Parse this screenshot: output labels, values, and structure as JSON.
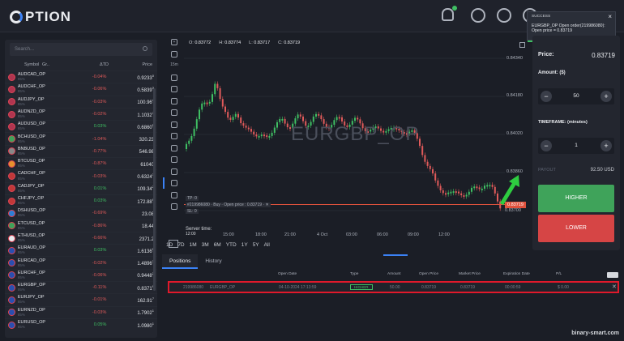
{
  "app": {
    "logo_text": "PTION"
  },
  "topbar": {
    "icons": [
      "bell-icon",
      "stats-icon",
      "gear-icon",
      "power-icon"
    ]
  },
  "toast": {
    "title": "SUCCESS",
    "line1": "EURGBP_OP Open order(219986080):",
    "line2": "Open price = 0.83719",
    "close": "×"
  },
  "search": {
    "placeholder": "Search..."
  },
  "assets_header": {
    "symbol": "Symbol",
    "group": "Gr..",
    "change": "ΔTD",
    "price": "Price"
  },
  "assets": [
    {
      "name": "AUDCAD_OP",
      "sub": "85%",
      "change": "-0.04%",
      "dir": "neg",
      "price": "0.9233",
      "sup": "0",
      "color": "#b03550"
    },
    {
      "name": "AUDCHF_OP",
      "sub": "85%",
      "change": "-0.06%",
      "dir": "neg",
      "price": "0.5839",
      "sup": "3",
      "color": "#b03550"
    },
    {
      "name": "AUDJPY_OP",
      "sub": "85%",
      "change": "-0.03%",
      "dir": "neg",
      "price": "100.96",
      "sup": "4",
      "color": "#b03550"
    },
    {
      "name": "AUDNZD_OP",
      "sub": "85%",
      "change": "-0.02%",
      "dir": "neg",
      "price": "1.1032",
      "sup": "7",
      "color": "#b03550"
    },
    {
      "name": "AUDUSD_OP",
      "sub": "85%",
      "change": "0.03%",
      "dir": "pos",
      "price": "0.6860",
      "sup": "5",
      "color": "#b03550"
    },
    {
      "name": "BCHUSD_OP",
      "sub": "85%",
      "change": "-1.04%",
      "dir": "neg",
      "price": "320.23",
      "sup": "",
      "color": "#3fa35a"
    },
    {
      "name": "BNBUSD_OP",
      "sub": "85%",
      "change": "-0.77%",
      "dir": "neg",
      "price": "546.98",
      "sup": "",
      "color": "#888"
    },
    {
      "name": "BTCUSD_OP",
      "sub": "85%",
      "change": "-0.87%",
      "dir": "neg",
      "price": "61040",
      "sup": "",
      "color": "#e8912d"
    },
    {
      "name": "CADCHF_OP",
      "sub": "85%",
      "change": "-0.03%",
      "dir": "neg",
      "price": "0.6324",
      "sup": "3",
      "color": "#c23838"
    },
    {
      "name": "CADJPY_OP",
      "sub": "85%",
      "change": "0.01%",
      "dir": "pos",
      "price": "109.34",
      "sup": "2",
      "color": "#c23838"
    },
    {
      "name": "CHFJPY_OP",
      "sub": "85%",
      "change": "0.03%",
      "dir": "pos",
      "price": "172.88",
      "sup": "9",
      "color": "#c23838"
    },
    {
      "name": "DSHUSD_OP",
      "sub": "85%",
      "change": "-0.69%",
      "dir": "neg",
      "price": "23.08",
      "sup": "",
      "color": "#2d7fd6"
    },
    {
      "name": "ETCUSD_OP",
      "sub": "85%",
      "change": "-0.86%",
      "dir": "neg",
      "price": "18.44",
      "sup": "",
      "color": "#3fa35a"
    },
    {
      "name": "ETHUSD_OP",
      "sub": "85%",
      "change": "-0.66%",
      "dir": "neg",
      "price": "2371.2",
      "sup": "",
      "color": "#e9ebef"
    },
    {
      "name": "EURAUD_OP",
      "sub": "85%",
      "change": "0.03%",
      "dir": "pos",
      "price": "1.6136",
      "sup": "9",
      "color": "#2a4fb0"
    },
    {
      "name": "EURCAD_OP",
      "sub": "85%",
      "change": "-0.02%",
      "dir": "neg",
      "price": "1.4896",
      "sup": "7",
      "color": "#2a4fb0"
    },
    {
      "name": "EURCHF_OP",
      "sub": "85%",
      "change": "-0.06%",
      "dir": "neg",
      "price": "0.9448",
      "sup": "2",
      "color": "#2a4fb0"
    },
    {
      "name": "EURGBP_OP",
      "sub": "85%",
      "change": "-0.11%",
      "dir": "neg",
      "price": "0.8371",
      "sup": "9",
      "color": "#2a4fb0"
    },
    {
      "name": "EURJPY_OP",
      "sub": "85%",
      "change": "-0.01%",
      "dir": "neg",
      "price": "162.91",
      "sup": "7",
      "color": "#2a4fb0"
    },
    {
      "name": "EURNZD_OP",
      "sub": "85%",
      "change": "-0.03%",
      "dir": "neg",
      "price": "1.7902",
      "sup": "1",
      "color": "#2a4fb0"
    },
    {
      "name": "EURUSD_OP",
      "sub": "85%",
      "change": "0.05%",
      "dir": "pos",
      "price": "1.0980",
      "sup": "1",
      "color": "#2a4fb0"
    }
  ],
  "chart": {
    "ohlc": {
      "o_label": "O:",
      "o": "0.83772",
      "h_label": "H:",
      "h": "0.83774",
      "l_label": "L:",
      "l": "0.83717",
      "c_label": "C:",
      "c": "0.83719"
    },
    "watermark": "EURGBP_OP",
    "interval": "15m",
    "y_ticks": [
      "0.84340",
      "0.84180",
      "0.84020",
      "0.83860",
      "0.83700"
    ],
    "current_tag": "0.83719",
    "x_ticks": [
      "15:00",
      "18:00",
      "21:00",
      "4 Oct",
      "03:00",
      "06:00",
      "09:00",
      "12:00"
    ],
    "tp_label": "TP: 0",
    "order_label": "#219986080 · Buy · Open price : 0.83719 · ✕",
    "sl_label": "SL: 0",
    "server_time_label": "Server time:",
    "server_time_value": "12:00",
    "ranges": [
      "1D",
      "7D",
      "1M",
      "3M",
      "6M",
      "YTD",
      "1Y",
      "5Y",
      "All"
    ]
  },
  "trade_panel": {
    "price_label": "Price:",
    "price": "0.83719",
    "amount_label": "Amount: ($)",
    "amount": "50",
    "timeframe_label": "TIMEFRAME: (minutes)",
    "timeframe": "1",
    "payout_label": "PAYOUT",
    "payout": "92.50 USD",
    "higher": "HIGHER",
    "lower": "LOWER",
    "minus": "−",
    "plus": "+"
  },
  "positions": {
    "tabs": [
      "Positions",
      "History"
    ],
    "headers": [
      "Open Date",
      "Type",
      "Amount",
      "Open Price",
      "Market Price",
      "Expiration Date",
      "P/L"
    ],
    "row": {
      "id": "219986080",
      "asset": "EURGBP_OP",
      "open_date": "04-10-2024 17:13:59",
      "type": "HIGHER",
      "amount": "50.00",
      "open_price": "0.83719",
      "market_price": "0.83719",
      "expiration": "00:00:59",
      "pl": "$ 0.00",
      "close": "✕"
    }
  },
  "watermark_site": "binary-smart.com",
  "colors": {
    "higher": "#3fa35a",
    "lower": "#d64545",
    "accent": "#3b82f6",
    "highlight": "#e0192b"
  }
}
